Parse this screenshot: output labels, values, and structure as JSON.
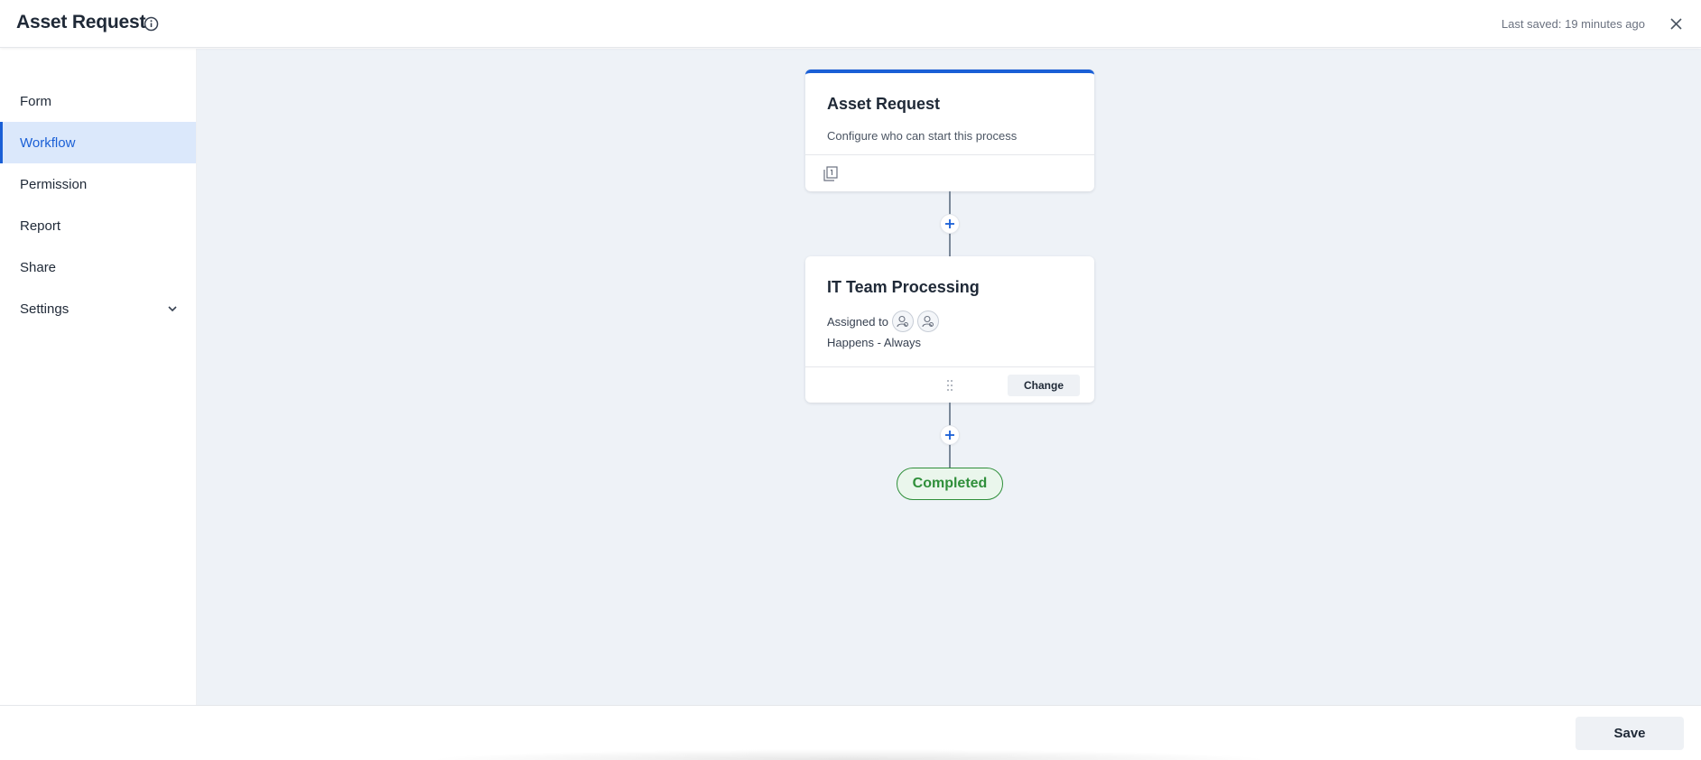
{
  "header": {
    "title": "Asset Request",
    "info_icon": "info-circle-icon",
    "last_saved": "Last saved: 19 minutes ago",
    "close_icon": "close-icon"
  },
  "sidebar": {
    "items": [
      {
        "label": "Form",
        "active": false
      },
      {
        "label": "Workflow",
        "active": true
      },
      {
        "label": "Permission",
        "active": false
      },
      {
        "label": "Report",
        "active": false
      },
      {
        "label": "Share",
        "active": false
      },
      {
        "label": "Settings",
        "active": false,
        "icon": "chevron-down-icon"
      }
    ]
  },
  "workflow": {
    "start_card": {
      "title": "Asset Request",
      "description": "Configure who can start this process",
      "footer_icon": "document-icon"
    },
    "step_card": {
      "title": "IT Team Processing",
      "assigned_label": "Assigned to",
      "assignee_icons": [
        "user-group-icon",
        "user-group-icon"
      ],
      "happens": "Happens - Always",
      "change_label": "Change"
    },
    "add_step_icon": "plus-icon",
    "end_label": "Completed"
  },
  "footer": {
    "save_label": "Save"
  },
  "colors": {
    "accent": "#1a5fd6",
    "active_nav_bg": "#dbe8fb",
    "canvas_bg": "#eef2f7",
    "completed": "#2f8f3a"
  }
}
